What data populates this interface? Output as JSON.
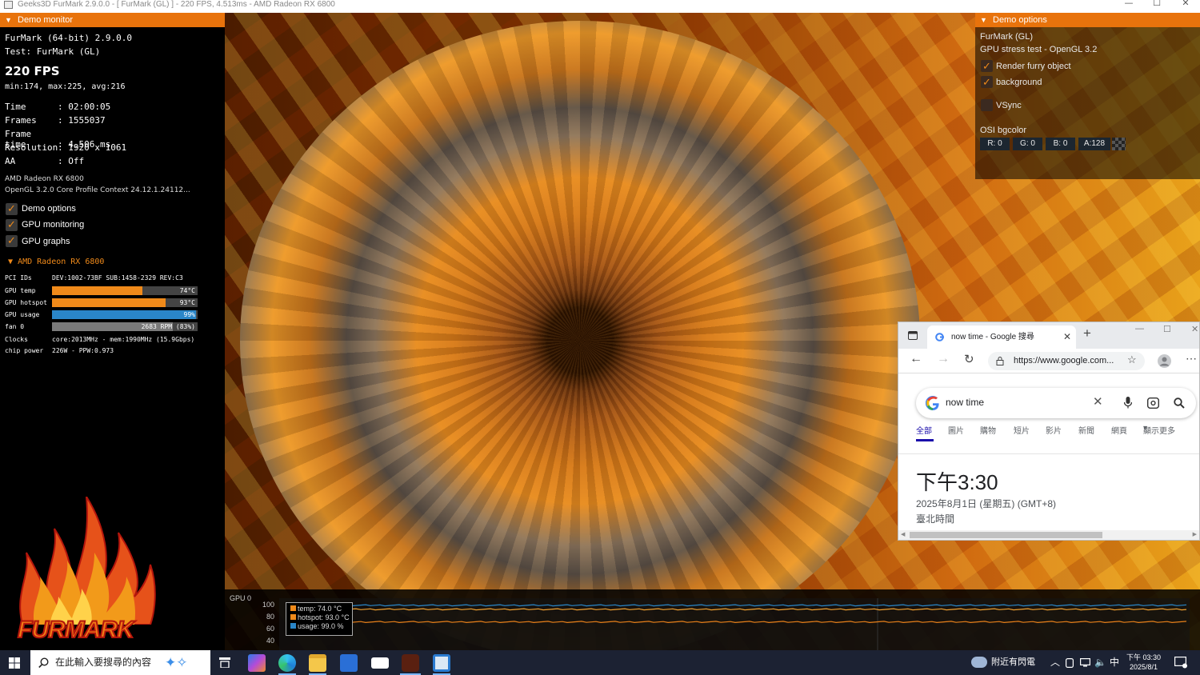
{
  "window": {
    "title": "Geeks3D FurMark 2.9.0.0 - [ FurMark (GL) ] - 220 FPS, 4.513ms - AMD Radeon RX 6800",
    "minimize_glyph": "—",
    "maximize_glyph": "☐",
    "close_glyph": "✕"
  },
  "demo_monitor": {
    "header": "Demo monitor",
    "app_name": "FurMark (64-bit) 2.9.0.0",
    "test": "Test: FurMark (GL)",
    "fps": "220 FPS",
    "fps_stats": "min:174, max:225, avg:216",
    "stats": [
      {
        "key": "Time",
        "value": ": 02:00:05"
      },
      {
        "key": "Frames",
        "value": ": 1555037"
      },
      {
        "key": "Frame time",
        "value": ": 4.506 ms"
      },
      {
        "key": "Resolution",
        "value": ": 1920 x 1061"
      },
      {
        "key": "AA",
        "value": ": Off"
      }
    ],
    "gpu_name": "AMD Radeon RX 6800",
    "gl_context": "OpenGL 3.2.0 Core Profile Context 24.12.1.24112...",
    "checkboxes": [
      {
        "label": "Demo options",
        "checked": true
      },
      {
        "label": "GPU monitoring",
        "checked": true
      },
      {
        "label": "GPU graphs",
        "checked": true
      }
    ],
    "gpu_section_title": "AMD Radeon RX 6800",
    "pci_label": "PCI IDs",
    "pci_value": "DEV:1002-73BF SUB:1458-2329 REV:C3",
    "bars": [
      {
        "label": "GPU temp",
        "value": "74°C",
        "fraction": 0.62,
        "color": "#f08a1a"
      },
      {
        "label": "GPU hotspot",
        "value": "93°C",
        "fraction": 0.78,
        "color": "#f08a1a"
      },
      {
        "label": "GPU usage",
        "value": "99%",
        "fraction": 0.99,
        "color": "#2a86c8"
      },
      {
        "label": "fan 0",
        "value": "2683 RPM (83%)",
        "fraction": 0.83,
        "color": "#7a7a7a"
      }
    ],
    "clocks_label": "Clocks",
    "clocks_value": "core:2013MHz - mem:1990MHz (15.9Gbps)",
    "power_label": "chip power",
    "power_value": "226W - PPW:0.973",
    "logo_text": "FURMARK"
  },
  "demo_options": {
    "header": "Demo options",
    "title": "FurMark (GL)",
    "subtitle": "GPU stress test - OpenGL 3.2",
    "checkboxes": [
      {
        "label": "Render furry object",
        "checked": true
      },
      {
        "label": "background",
        "checked": true
      },
      {
        "label": "VSync",
        "checked": false
      }
    ],
    "osi_label": "OSI bgcolor",
    "rgba": [
      {
        "label": "R: 0"
      },
      {
        "label": "G: 0"
      },
      {
        "label": "B: 0"
      },
      {
        "label": "A:128"
      }
    ]
  },
  "browser": {
    "tab_title": "now time - Google 搜尋",
    "url": "https://www.google.com...",
    "search_query": "now time",
    "nav_tabs": [
      "全部",
      "圖片",
      "購物",
      "短片",
      "影片",
      "新聞",
      "網頁",
      "顯示更多"
    ],
    "result_time": "下午3:30",
    "result_date": "2025年8月1日 (星期五) (GMT+8)",
    "result_zone": "臺北時間"
  },
  "graph": {
    "title": "GPU 0",
    "y_ticks": [
      "100",
      "80",
      "60",
      "40"
    ],
    "legend": [
      {
        "label": "temp: 74.0 °C",
        "color": "#f08a1a"
      },
      {
        "label": "hotspot: 93.0 °C",
        "color": "#f08a1a"
      },
      {
        "label": "usage: 99.0 %",
        "color": "#2a86c8"
      }
    ],
    "series": [
      {
        "name": "temp",
        "value": 74.0,
        "color": "#e8801a"
      },
      {
        "name": "hotspot",
        "value": 93.0,
        "color": "#f0a030"
      },
      {
        "name": "usage",
        "value": 99.0,
        "color": "#2a86c8"
      }
    ],
    "y_range": [
      40,
      100
    ]
  },
  "taskbar": {
    "search_placeholder": "在此輸入要搜尋的內容",
    "weather": "附近有閃電",
    "ime": "中",
    "time": "下午 03:30",
    "date": "2025/8/1"
  }
}
